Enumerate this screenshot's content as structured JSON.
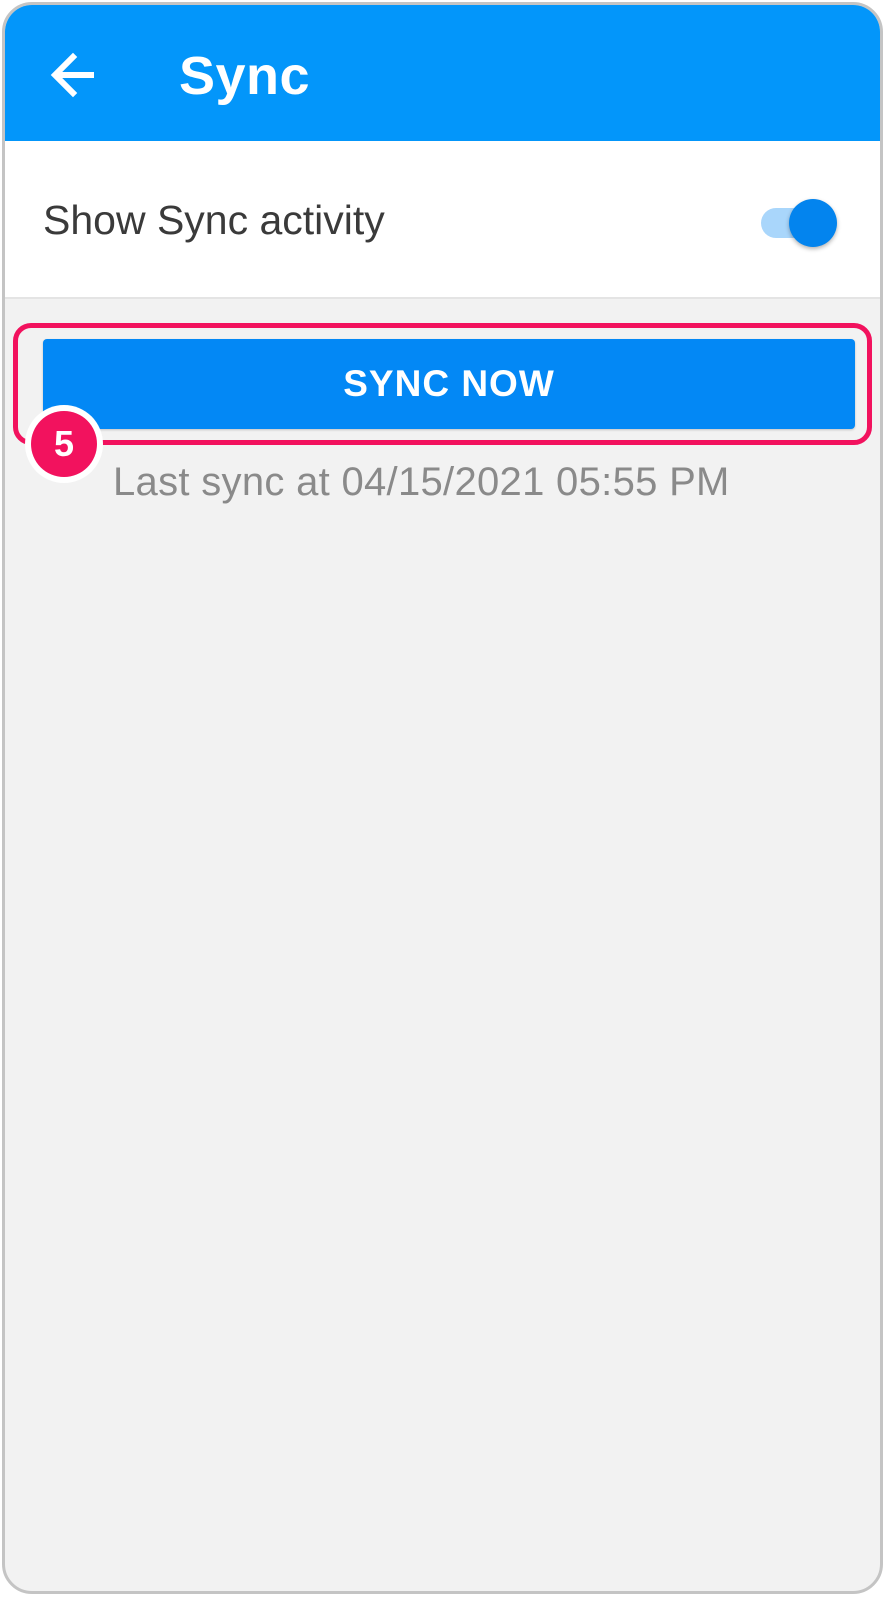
{
  "header": {
    "title": "Sync",
    "back_icon": "arrow-left-icon"
  },
  "settings": {
    "show_sync_activity_label": "Show Sync activity",
    "show_sync_activity_enabled": true
  },
  "sync": {
    "button_label": "SYNC NOW",
    "last_sync_text": "Last sync at 04/15/2021 05:55 PM"
  },
  "annotation": {
    "step_number": "5"
  },
  "colors": {
    "app_bar": "#0396fa",
    "primary": "#0388f5",
    "highlight": "#f2125e",
    "background": "#f2f2f2"
  }
}
